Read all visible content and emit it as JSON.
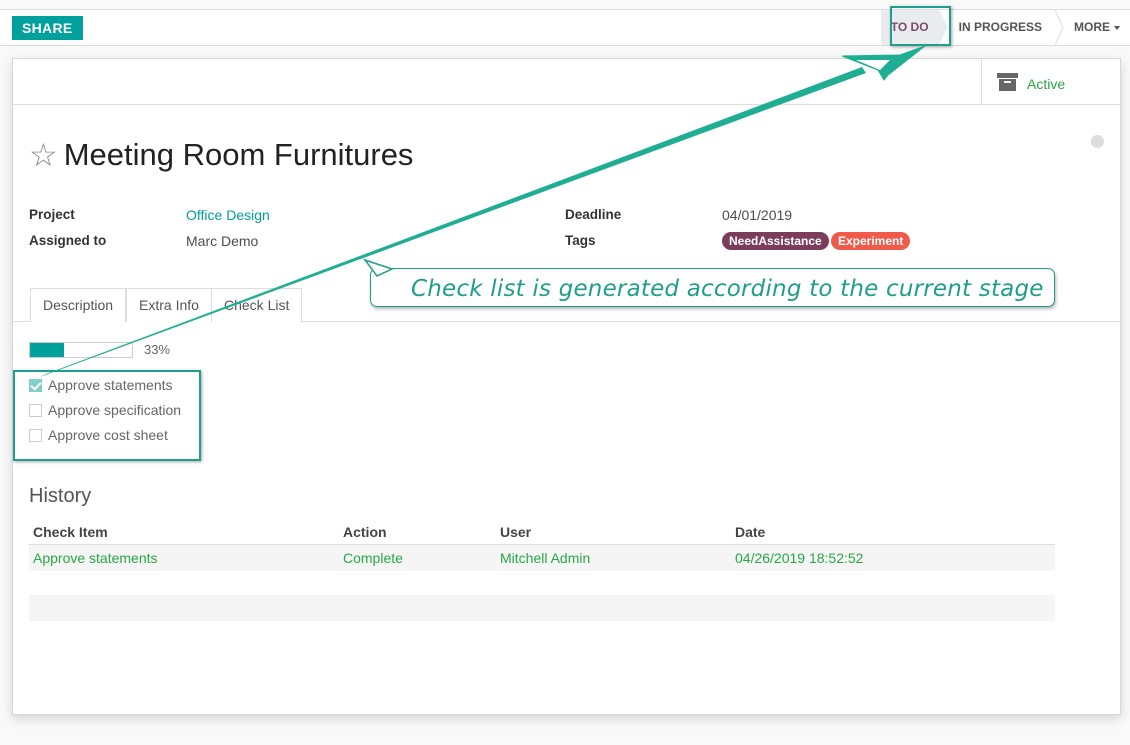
{
  "toolbar": {
    "share_label": "SHARE"
  },
  "stages": {
    "todo": "TO DO",
    "in_progress": "IN PROGRESS",
    "more": "MORE"
  },
  "status_button": {
    "label": "Active",
    "icon": "archive-icon"
  },
  "task": {
    "title": "Meeting Room Furnitures",
    "favorite_icon": "star-outline-icon"
  },
  "fields": {
    "project_label": "Project",
    "project_value": "Office Design",
    "assigned_label": "Assigned to",
    "assigned_value": "Marc Demo",
    "deadline_label": "Deadline",
    "deadline_value": "04/01/2019",
    "tags_label": "Tags",
    "tags": [
      "NeedAssistance",
      "Experiment"
    ]
  },
  "tabs": [
    "Description",
    "Extra Info",
    "Check List"
  ],
  "checklist": {
    "progress_percent": 33,
    "progress_text": "33%",
    "items": [
      {
        "label": "Approve statements",
        "checked": true
      },
      {
        "label": "Approve specification",
        "checked": false
      },
      {
        "label": "Approve cost sheet",
        "checked": false
      }
    ]
  },
  "history": {
    "title": "History",
    "columns": [
      "Check Item",
      "Action",
      "User",
      "Date"
    ],
    "rows": [
      [
        "Approve statements",
        "Complete",
        "Mitchell Admin",
        "04/26/2019 18:52:52"
      ]
    ]
  },
  "annotation": {
    "text": "Check list is generated according to the current stage"
  },
  "colors": {
    "accent": "#00a09d",
    "annotation": "#1f9e8d",
    "tag_need": "#7c3d5d",
    "tag_exp": "#ef5a4b",
    "success": "#28a745"
  }
}
